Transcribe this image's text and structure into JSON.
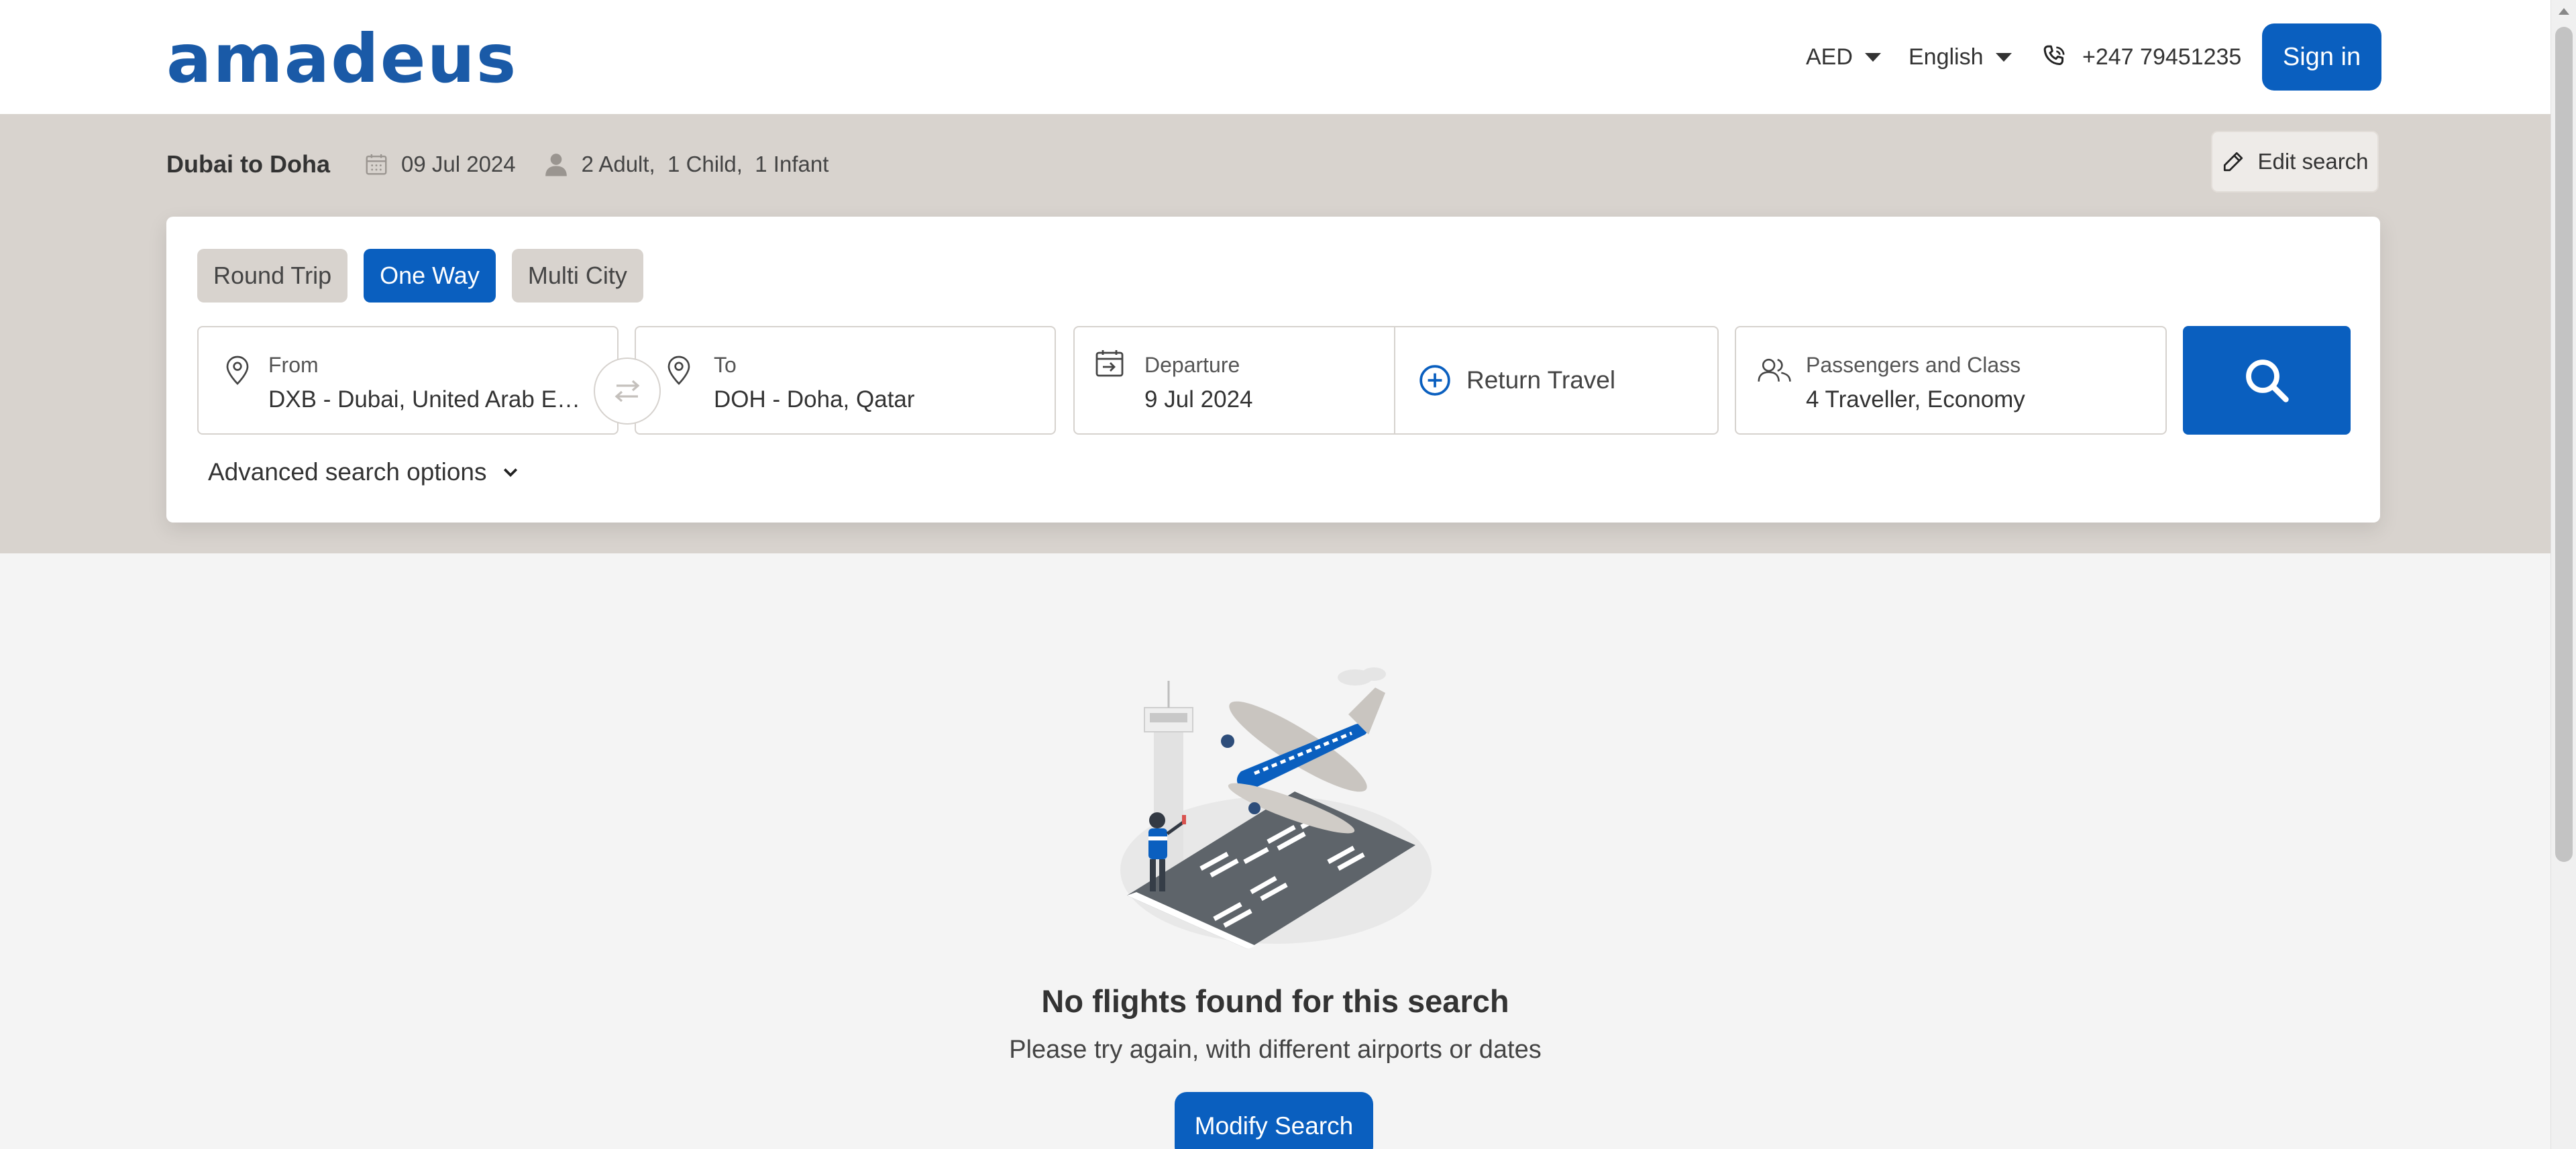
{
  "header": {
    "logo": "amadeus",
    "currency": "AED",
    "language": "English",
    "phone": "+247 79451235",
    "sign_in": "Sign in"
  },
  "summary": {
    "route": "Dubai to Doha",
    "date": "09 Jul 2024",
    "passengers": "2 Adult,  1 Child,  1 Infant",
    "edit_label": "Edit search"
  },
  "search": {
    "trip_types": [
      "Round Trip",
      "One Way",
      "Multi City"
    ],
    "selected_trip": "One Way",
    "from_label": "From",
    "from_value": "DXB - Dubai, United Arab Emirates",
    "to_label": "To",
    "to_value": "DOH - Doha, Qatar",
    "departure_label": "Departure",
    "departure_value": "9 Jul 2024",
    "return_label": "Return Travel",
    "pax_label": "Passengers and Class",
    "pax_value": "4 Traveller, Economy",
    "advanced": "Advanced search options"
  },
  "empty_state": {
    "title": "No flights found for this search",
    "subtitle": "Please try again, with different airports or dates",
    "button": "Modify Search"
  },
  "colors": {
    "primary": "#0a5fbf",
    "logo": "#1a5aa7",
    "band": "#d8d3ce",
    "page_bg": "#f4f4f4"
  }
}
